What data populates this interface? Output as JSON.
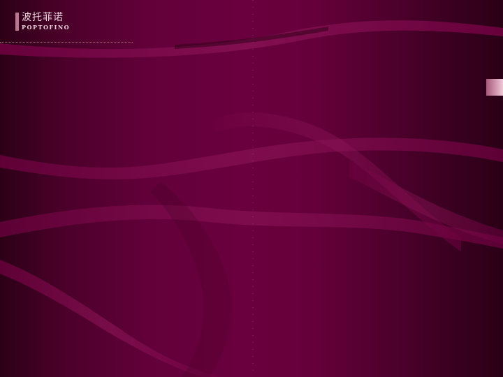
{
  "brand": {
    "name_cn": "波托菲诺",
    "name_en": "POPTOFINO"
  },
  "colors": {
    "background": "#63003a",
    "ribbon": "#7a0a4a",
    "accent_bar": "#b9788f",
    "text": "#ecd4dc"
  }
}
